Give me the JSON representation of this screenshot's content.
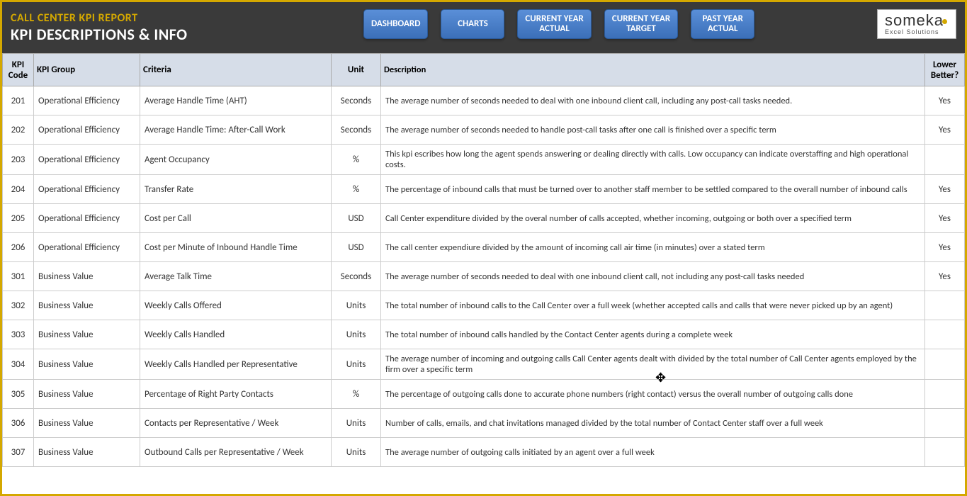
{
  "header": {
    "report_title": "CALL CENTER KPI REPORT",
    "page_title": "KPI DESCRIPTIONS & INFO"
  },
  "nav": {
    "dashboard": "DASHBOARD",
    "charts": "CHARTS",
    "current_year_actual": "CURRENT YEAR\nACTUAL",
    "current_year_target": "CURRENT YEAR\nTARGET",
    "past_year_actual": "PAST YEAR\nACTUAL"
  },
  "logo": {
    "brand": "someka",
    "tagline": "Excel Solutions"
  },
  "table": {
    "headers": {
      "code": "KPI Code",
      "group": "KPI Group",
      "criteria": "Criteria",
      "unit": "Unit",
      "description": "Description",
      "lower": "Lower Better?"
    },
    "rows": [
      {
        "code": "201",
        "group": "Operational Efficiency",
        "criteria": "Average Handle Time (AHT)",
        "unit": "Seconds",
        "desc": "The average number of seconds needed to deal with one inbound client call, including any post-call tasks needed.",
        "lower": "Yes"
      },
      {
        "code": "202",
        "group": "Operational Efficiency",
        "criteria": "Average Handle Time: After-Call Work",
        "unit": "Seconds",
        "desc": "The average number of seconds needed to handle post-call tasks after one call is finished over a specific term",
        "lower": "Yes"
      },
      {
        "code": "203",
        "group": "Operational Efficiency",
        "criteria": "Agent Occupancy",
        "unit": "%",
        "desc": "This kpi escribes how long the agent spends answering or dealing directly with calls. Low occupancy can indicate overstaffing and high operational costs.",
        "lower": ""
      },
      {
        "code": "204",
        "group": "Operational Efficiency",
        "criteria": "Transfer Rate",
        "unit": "%",
        "desc": "The percentage of inbound calls that must be turned over to another staff member to be settled compared to the overall number of inbound calls",
        "lower": "Yes"
      },
      {
        "code": "205",
        "group": "Operational Efficiency",
        "criteria": "Cost per Call",
        "unit": "USD",
        "desc": "Call Center expenditure divided by the overal number of calls accepted, whether incoming, outgoing or both over a specified term",
        "lower": "Yes"
      },
      {
        "code": "206",
        "group": "Operational Efficiency",
        "criteria": "Cost per Minute of Inbound Handle Time",
        "unit": "USD",
        "desc": "The call center expendiure divided by the amount of incoming call air time (in minutes) over a stated term",
        "lower": "Yes"
      },
      {
        "code": "301",
        "group": "Business Value",
        "criteria": "Average Talk Time",
        "unit": "Seconds",
        "desc": "The average number of seconds needed to deal with one inbound client call, not including any post-call tasks needed",
        "lower": "Yes"
      },
      {
        "code": "302",
        "group": "Business Value",
        "criteria": "Weekly Calls Offered",
        "unit": "Units",
        "desc": "The total number of inbound calls to the Call Center over a full week (whether accepted calls and calls that were never picked up by an agent)",
        "lower": ""
      },
      {
        "code": "303",
        "group": "Business Value",
        "criteria": "Weekly Calls Handled",
        "unit": "Units",
        "desc": "The total number of inbound calls handled by the Contact Center agents during a complete week",
        "lower": ""
      },
      {
        "code": "304",
        "group": "Business Value",
        "criteria": "Weekly Calls Handled per Representative",
        "unit": "Units",
        "desc": "The average number of incoming and outgoing calls Call Center agents dealt with divided by the total number of Call Center agents employed by the firm over a specific term",
        "lower": ""
      },
      {
        "code": "305",
        "group": "Business Value",
        "criteria": "Percentage of Right Party Contacts",
        "unit": "%",
        "desc": "The percentage of outgoing calls done to accurate phone numbers (right contact) versus the overall number of outgoing calls done",
        "lower": ""
      },
      {
        "code": "306",
        "group": "Business Value",
        "criteria": "Contacts per Representative / Week",
        "unit": "Units",
        "desc": "Number of calls, emails, and chat invitations managed divided by the total number of Contact Center staff over a full week",
        "lower": ""
      },
      {
        "code": "307",
        "group": "Business Value",
        "criteria": "Outbound Calls per Representative / Week",
        "unit": "Units",
        "desc": "The average number of outgoing calls initiated by an agent over a full week",
        "lower": ""
      }
    ]
  }
}
